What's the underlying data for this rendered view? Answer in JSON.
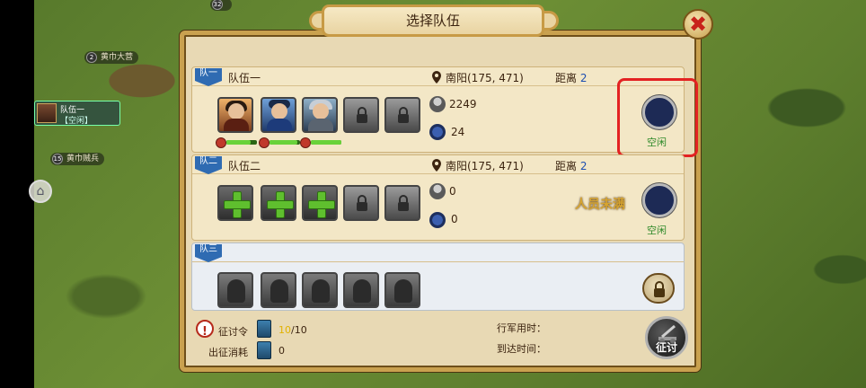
{
  "dialog": {
    "title": "选择队伍",
    "close_label": "✖"
  },
  "map": {
    "labels": [
      {
        "level": "2",
        "name": "黄巾大营"
      },
      {
        "level": "15",
        "name": "黄巾贼兵"
      },
      {
        "level": "32",
        "name": ""
      }
    ],
    "team_chip": {
      "line1": "队伍一",
      "line2": "【空闲】"
    }
  },
  "teams": [
    {
      "tag": "队一",
      "name": "队伍一",
      "location": "南阳(175, 471)",
      "distance_label": "距离",
      "distance": "2",
      "troops": "2249",
      "food": "24",
      "status": "空闲",
      "slots": [
        "hero",
        "hero",
        "hero",
        "locked",
        "locked"
      ],
      "hp": [
        0.8,
        0.9,
        1.0
      ]
    },
    {
      "tag": "队二",
      "name": "队伍二",
      "location": "南阳(175, 471)",
      "distance_label": "距离",
      "distance": "2",
      "troops": "0",
      "food": "0",
      "status": "空闲",
      "note": "人员未满",
      "slots": [
        "add",
        "add",
        "add",
        "locked",
        "locked"
      ]
    },
    {
      "tag": "队三",
      "slots": [
        "silhouette",
        "silhouette",
        "silhouette",
        "silhouette",
        "silhouette"
      ]
    }
  ],
  "footer": {
    "campaign_order_label": "征讨令",
    "campaign_order_current": "10",
    "campaign_order_max": "/10",
    "cost_label": "出征消耗",
    "cost_value": "0",
    "march_time_label": "行军用时：",
    "arrival_time_label": "到达时间：",
    "attack_label": "征讨"
  },
  "colors": {
    "distance": "#1e4fb0",
    "status_idle": "#2f8a2a",
    "highlight": "#e32222",
    "note": "#d6a430"
  }
}
